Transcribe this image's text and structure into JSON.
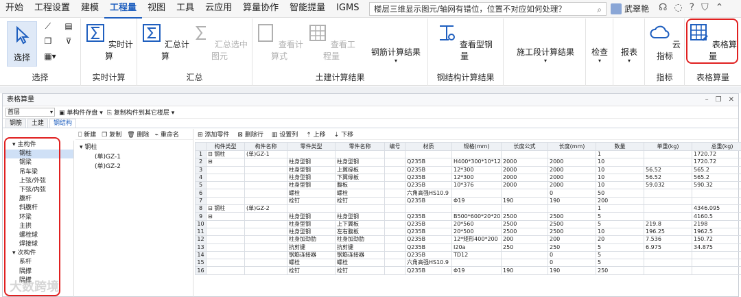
{
  "menu": [
    "开始",
    "工程设置",
    "建模",
    "工程量",
    "视图",
    "工具",
    "云应用",
    "算量协作",
    "智能提量",
    "IGMS"
  ],
  "active_menu": "工程量",
  "search_text": "楼层三维显示图元/轴网有错位，位置不对应如何处理？",
  "user_name": "武翠艳",
  "ribbon": {
    "select": {
      "btn": "选择",
      "group": "选择"
    },
    "realtime": {
      "btn": "实时计算",
      "group": "实时计算"
    },
    "summary": {
      "btn1": "汇总计算",
      "btn2": "汇总选中图元",
      "group": "汇总"
    },
    "civil": {
      "btn1": "查看计算式",
      "btn2": "查看工程量",
      "btn3": "钢筋计算结果",
      "group": "土建计算结果"
    },
    "steel": {
      "btn": "查看型钢量",
      "group": "钢结构计算结果"
    },
    "stage": {
      "btn": "施工段计算结果"
    },
    "check": {
      "btn": "检查"
    },
    "report": {
      "btn": "报表"
    },
    "index": {
      "btn": "云指标",
      "group": "指标"
    },
    "table": {
      "btn": "表格算量",
      "group": "表格算量"
    }
  },
  "panel": {
    "title": "表格算量",
    "floor": "首层",
    "tb1": [
      "单构件存盘",
      "复制构件到其它楼层"
    ],
    "tabs": [
      "钢筋",
      "土建",
      "钢结构"
    ],
    "active_tab": "钢结构"
  },
  "tree": [
    {
      "label": "主构件",
      "level": 0,
      "exp": "▾"
    },
    {
      "label": "钢柱",
      "level": 1,
      "sel": true
    },
    {
      "label": "钢梁",
      "level": 1
    },
    {
      "label": "吊车梁",
      "level": 1
    },
    {
      "label": "上弦/外弦",
      "level": 1
    },
    {
      "label": "下弦/内弦",
      "level": 1
    },
    {
      "label": "腹杆",
      "level": 1
    },
    {
      "label": "斜腹杆",
      "level": 1
    },
    {
      "label": "环梁",
      "level": 1
    },
    {
      "label": "主拱",
      "level": 1
    },
    {
      "label": "螺栓球",
      "level": 1
    },
    {
      "label": "焊接球",
      "level": 1
    },
    {
      "label": "次构件",
      "level": 0,
      "exp": "▾"
    },
    {
      "label": "系杆",
      "level": 1
    },
    {
      "label": "隅撑",
      "level": 1
    },
    {
      "label": "隅撑",
      "level": 1
    }
  ],
  "mid": {
    "toolbar": [
      "新建",
      "复制",
      "删除",
      "重命名"
    ],
    "items": [
      "钢柱",
      "(单)GZ-1",
      "(单)GZ-2"
    ]
  },
  "right": {
    "toolbar": [
      "添加零件",
      "删除行",
      "设置列",
      "上移",
      "下移"
    ],
    "headers": [
      "",
      "构件类型",
      "构件名称",
      "零件类型",
      "零件名称",
      "编号",
      "材质",
      "规格(mm)",
      "长度公式",
      "长度(mm)",
      "数量",
      "单重(kg)",
      "总重(kg)"
    ],
    "rows": [
      [
        "1",
        "⊟ 钢柱",
        "(单)GZ-1",
        "",
        "",
        "",
        "",
        "",
        "",
        "",
        "1",
        "",
        "1720.72"
      ],
      [
        "2",
        "⊟",
        "",
        "柱身型钢",
        "柱身型钢",
        "",
        "Q235B",
        "H400*300*10*12",
        "2000",
        "2000",
        "10",
        "",
        "1720.72"
      ],
      [
        "3",
        "",
        "",
        "柱身型钢",
        "上翼缘板",
        "",
        "Q235B",
        "12*300",
        "2000",
        "2000",
        "10",
        "56.52",
        "565.2"
      ],
      [
        "4",
        "",
        "",
        "柱身型钢",
        "下翼缘板",
        "",
        "Q235B",
        "12*300",
        "2000",
        "2000",
        "10",
        "56.52",
        "565.2"
      ],
      [
        "5",
        "",
        "",
        "柱身型钢",
        "腹板",
        "",
        "Q235B",
        "10*376",
        "2000",
        "2000",
        "10",
        "59.032",
        "590.32"
      ],
      [
        "6",
        "",
        "",
        "螺栓",
        "螺栓",
        "",
        "六角高强HS10.9",
        "",
        "",
        "0",
        "50",
        "",
        ""
      ],
      [
        "7",
        "",
        "",
        "栓钉",
        "栓钉",
        "",
        "Q235B",
        "Φ19",
        "190",
        "190",
        "200",
        "",
        ""
      ],
      [
        "8",
        "⊟ 钢柱",
        "(单)GZ-2",
        "",
        "",
        "",
        "",
        "",
        "",
        "",
        "1",
        "",
        "4346.095"
      ],
      [
        "9",
        "⊟",
        "",
        "柱身型钢",
        "柱身型钢",
        "",
        "Q235B",
        "B500*600*20*20",
        "2500",
        "2500",
        "5",
        "",
        "4160.5"
      ],
      [
        "10",
        "",
        "",
        "柱身型钢",
        "上下翼板",
        "",
        "Q235B",
        "20*560",
        "2500",
        "2500",
        "5",
        "219.8",
        "2198"
      ],
      [
        "11",
        "",
        "",
        "柱身型钢",
        "左右腹板",
        "",
        "Q235B",
        "20*500",
        "2500",
        "2500",
        "10",
        "196.25",
        "1962.5"
      ],
      [
        "12",
        "",
        "",
        "柱身加劲肋",
        "柱身加劲肋",
        "",
        "Q235B",
        "12*矩形400*200",
        "200",
        "200",
        "20",
        "7.536",
        "150.72"
      ],
      [
        "13",
        "",
        "",
        "抗剪键",
        "抗剪键",
        "",
        "Q235B",
        "I20a",
        "250",
        "250",
        "5",
        "6.975",
        "34.875"
      ],
      [
        "14",
        "",
        "",
        "钢筋连接器",
        "钢筋连接器",
        "",
        "Q235B",
        "TD12",
        "",
        "0",
        "5",
        "",
        ""
      ],
      [
        "15",
        "",
        "",
        "螺栓",
        "螺栓",
        "",
        "六角高强HS10.9",
        "",
        "",
        "0",
        "5",
        "",
        ""
      ],
      [
        "16",
        "",
        "",
        "栓钉",
        "栓钉",
        "",
        "Q235B",
        "Φ19",
        "190",
        "190",
        "250",
        "",
        ""
      ]
    ]
  },
  "watermark": "大数跨境"
}
